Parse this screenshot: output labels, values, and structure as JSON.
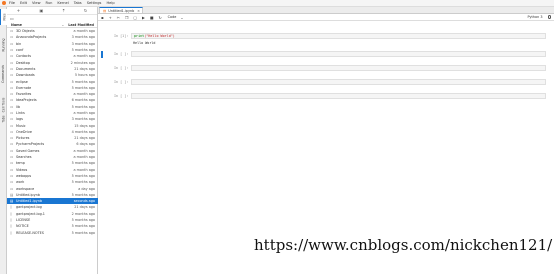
{
  "menubar": {
    "items": [
      "File",
      "Edit",
      "View",
      "Run",
      "Kernel",
      "Tabs",
      "Settings",
      "Help"
    ]
  },
  "activity_tabs": [
    "Files",
    "Running",
    "Commands",
    "Cell Tools",
    "Tabs"
  ],
  "filebrowser": {
    "toolbar_icons": [
      "add-icon",
      "new-folder-icon",
      "upload-icon",
      "refresh-icon"
    ],
    "header": {
      "name": "Name",
      "modified": "Last Modified"
    },
    "files": [
      {
        "name": "3D Objects",
        "modified": "a month ago",
        "type": "folder"
      },
      {
        "name": "AnacondaProjects",
        "modified": "3 months ago",
        "type": "folder"
      },
      {
        "name": "bin",
        "modified": "3 months ago",
        "type": "folder"
      },
      {
        "name": "conf",
        "modified": "5 months ago",
        "type": "folder"
      },
      {
        "name": "Contacts",
        "modified": "a month ago",
        "type": "folder"
      },
      {
        "name": "Desktop",
        "modified": "2 minutes ago",
        "type": "folder"
      },
      {
        "name": "Documents",
        "modified": "21 days ago",
        "type": "folder"
      },
      {
        "name": "Downloads",
        "modified": "5 hours ago",
        "type": "folder"
      },
      {
        "name": "eclipse",
        "modified": "5 months ago",
        "type": "folder"
      },
      {
        "name": "Evernote",
        "modified": "5 months ago",
        "type": "folder"
      },
      {
        "name": "Favorites",
        "modified": "a month ago",
        "type": "folder"
      },
      {
        "name": "IdeaProjects",
        "modified": "6 months ago",
        "type": "folder"
      },
      {
        "name": "lib",
        "modified": "5 months ago",
        "type": "folder"
      },
      {
        "name": "Links",
        "modified": "a month ago",
        "type": "folder"
      },
      {
        "name": "logs",
        "modified": "3 months ago",
        "type": "folder"
      },
      {
        "name": "Music",
        "modified": "15 days ago",
        "type": "folder"
      },
      {
        "name": "OneDrive",
        "modified": "4 months ago",
        "type": "folder"
      },
      {
        "name": "Pictures",
        "modified": "21 days ago",
        "type": "folder"
      },
      {
        "name": "PycharmProjects",
        "modified": "6 days ago",
        "type": "folder"
      },
      {
        "name": "Saved Games",
        "modified": "a month ago",
        "type": "folder"
      },
      {
        "name": "Searches",
        "modified": "a month ago",
        "type": "folder"
      },
      {
        "name": "temp",
        "modified": "5 months ago",
        "type": "folder"
      },
      {
        "name": "Videos",
        "modified": "a month ago",
        "type": "folder"
      },
      {
        "name": "webapps",
        "modified": "5 months ago",
        "type": "folder"
      },
      {
        "name": "work",
        "modified": "5 months ago",
        "type": "folder"
      },
      {
        "name": "workspace",
        "modified": "a day ago",
        "type": "folder"
      },
      {
        "name": "Untitled.ipynb",
        "modified": "5 months ago",
        "type": "notebook"
      },
      {
        "name": "Untitled1.ipynb",
        "modified": "seconds ago",
        "type": "notebook",
        "selected": true
      },
      {
        "name": "gantproject.log",
        "modified": "21 days ago",
        "type": "file"
      },
      {
        "name": "gantproject.log.1",
        "modified": "2 months ago",
        "type": "file"
      },
      {
        "name": "LICENSE",
        "modified": "5 months ago",
        "type": "file"
      },
      {
        "name": "NOTICE",
        "modified": "5 months ago",
        "type": "file"
      },
      {
        "name": "RELEASE-NOTES",
        "modified": "5 months ago",
        "type": "file"
      }
    ]
  },
  "notebook": {
    "tab_title": "Untitled1.ipynb",
    "celltype": "Code",
    "kernel": "Python 3",
    "cells": [
      {
        "prompt": "In [1]:",
        "code_kw": "print",
        "code_str": "(\"Hello World\")",
        "output": "Hello World"
      },
      {
        "prompt": "In [ ]:",
        "code_kw": "",
        "code_str": "",
        "output": ""
      },
      {
        "prompt": "In [ ]:",
        "code_kw": "",
        "code_str": "",
        "output": ""
      },
      {
        "prompt": "In [ ]:",
        "code_kw": "",
        "code_str": "",
        "output": ""
      },
      {
        "prompt": "In [ ]:",
        "code_kw": "",
        "code_str": "",
        "output": ""
      }
    ]
  },
  "watermark": "https://www.cnblogs.com/nickchen121/"
}
